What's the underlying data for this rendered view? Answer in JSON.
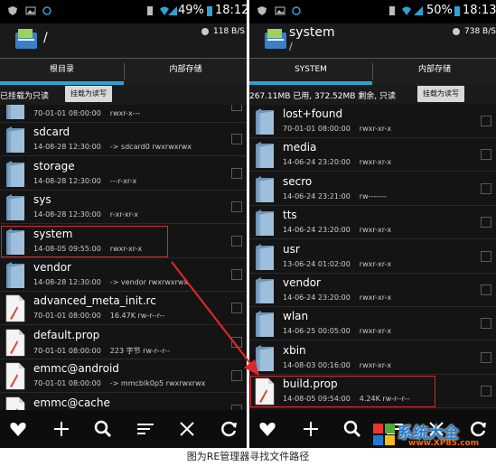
{
  "caption": "图为RE管理器寻找文件路径",
  "watermark": {
    "text": "系统大全",
    "url": "www.XP85.com"
  },
  "colors": {
    "accent": "#2ea2d8",
    "highlight": "#d8282f",
    "folder": "#8fb2cf"
  },
  "left": {
    "status": {
      "battery": "49%",
      "time": "18:12"
    },
    "header": {
      "title": "/",
      "speed": "118 B/S"
    },
    "tabs": [
      "根目录",
      "内部存储"
    ],
    "info": {
      "text": "已挂载为只读",
      "button": "挂载为读写"
    },
    "files": [
      {
        "name": "",
        "date": "70-01-01 08:00:00",
        "perm": "rwxr-x---",
        "type": "folder"
      },
      {
        "name": "sdcard",
        "date": "14-08-28 12:30:00",
        "perm": "-> sdcard0 rwxrwxrwx",
        "type": "folder"
      },
      {
        "name": "storage",
        "date": "14-08-28 12:30:00",
        "perm": "---r-xr-x",
        "type": "folder"
      },
      {
        "name": "sys",
        "date": "14-08-28 12:30:00",
        "perm": "r-xr-xr-x",
        "type": "folder"
      },
      {
        "name": "system",
        "date": "14-08-05 09:55:00",
        "perm": "rwxr-xr-x",
        "type": "folder",
        "highlight": true
      },
      {
        "name": "vendor",
        "date": "14-08-28 12:30:00",
        "perm": "-> vendor rwxrwxrwx",
        "type": "folder"
      },
      {
        "name": "advanced_meta_init.rc",
        "date": "70-01-01 08:00:00",
        "perm": "16.47K rw-r--r--",
        "type": "file"
      },
      {
        "name": "default.prop",
        "date": "70-01-01 08:00:00",
        "perm": "223 字节 rw-r--r--",
        "type": "file"
      },
      {
        "name": "emmc@android",
        "date": "70-01-01 08:00:00",
        "perm": "-> mmcblk0p5 rwxrwxrwx",
        "type": "file"
      },
      {
        "name": "emmc@cache",
        "date": "",
        "perm": "",
        "type": "file"
      }
    ]
  },
  "right": {
    "status": {
      "battery": "50%",
      "time": "18:13"
    },
    "header": {
      "title": "system",
      "subtitle": "/",
      "speed": "738 B/S"
    },
    "tabs": [
      "SYSTEM",
      "内部存储"
    ],
    "info": {
      "text": "267.11MB 已用, 372.52MB 剩余, 只读",
      "button": "挂载为读写"
    },
    "files": [
      {
        "name": "lost+found",
        "date": "70-01-01 08:00:00",
        "perm": "rwxr-xr-x",
        "type": "folder"
      },
      {
        "name": "media",
        "date": "14-06-24 23:20:00",
        "perm": "rwxr-xr-x",
        "type": "folder"
      },
      {
        "name": "secro",
        "date": "14-06-24 23:21:00",
        "perm": "rw-------",
        "type": "folder"
      },
      {
        "name": "tts",
        "date": "14-06-24 23:20:00",
        "perm": "rwxr-xr-x",
        "type": "folder"
      },
      {
        "name": "usr",
        "date": "13-06-24 01:02:00",
        "perm": "rwxr-xr-x",
        "type": "folder"
      },
      {
        "name": "vendor",
        "date": "14-06-24 23:20:00",
        "perm": "rwxr-xr-x",
        "type": "folder"
      },
      {
        "name": "wlan",
        "date": "14-06-25 00:05:00",
        "perm": "rwxr-xr-x",
        "type": "folder"
      },
      {
        "name": "xbin",
        "date": "14-08-03 00:16:00",
        "perm": "rwxr-xr-x",
        "type": "folder"
      },
      {
        "name": "build.prop",
        "date": "14-08-05 09:54:00",
        "perm": "4.24K rw-r--r--",
        "type": "file",
        "highlight": true
      }
    ]
  }
}
